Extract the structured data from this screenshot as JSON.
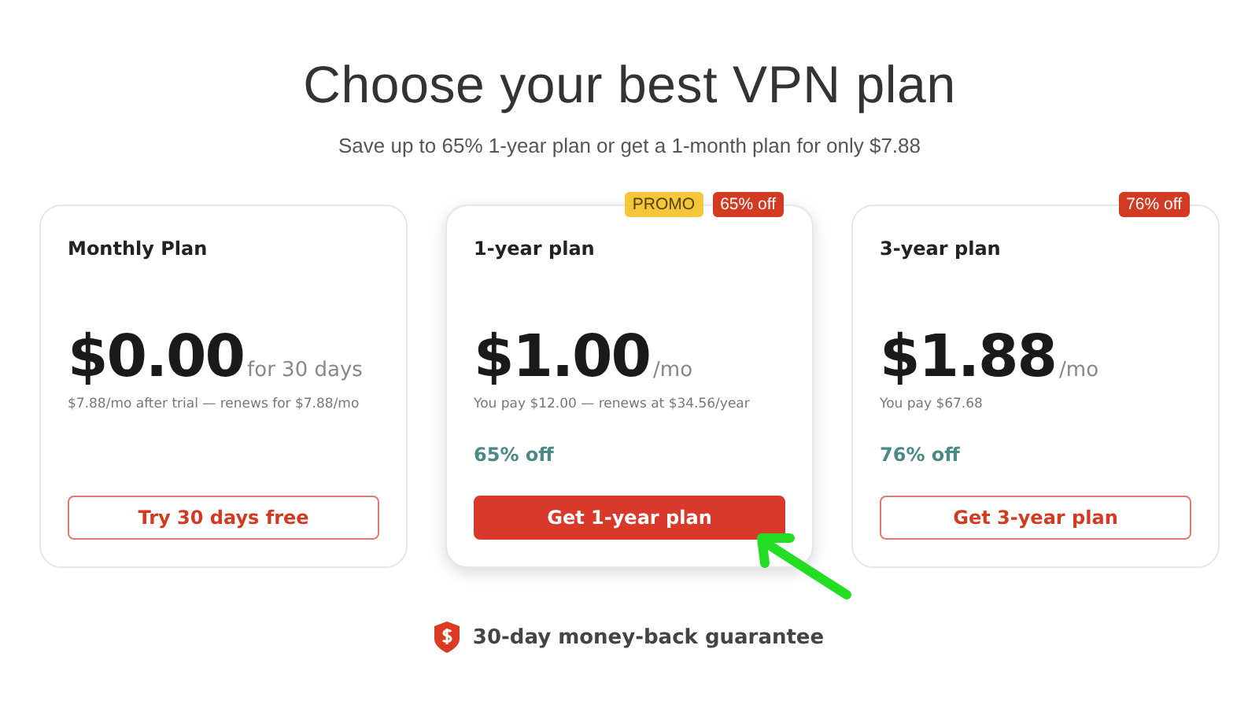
{
  "heading": "Choose your best VPN plan",
  "subheading": "Save up to 65% 1-year plan or get a 1-month plan for only $7.88",
  "plans": [
    {
      "name": "Monthly Plan",
      "featured": false,
      "price": "$0.00",
      "period": "for 30 days",
      "note": "$7.88/mo after trial — renews for $7.88/mo",
      "button": "Try 30 days free"
    },
    {
      "name": "1-year plan",
      "featured": true,
      "badges": [
        {
          "kind": "promo",
          "text": "PROMO"
        },
        {
          "kind": "discount",
          "text": "65% off"
        }
      ],
      "price": "$1.00",
      "period": "/mo",
      "note": "You pay $12.00 — renews at $34.56/year",
      "discount": "65% off",
      "button": "Get 1-year plan"
    },
    {
      "name": "3-year plan",
      "featured": false,
      "badges": [
        {
          "kind": "discount",
          "text": "76% off"
        }
      ],
      "price": "$1.88",
      "period": "/mo",
      "note": "You pay $67.68",
      "discount": "76% off",
      "button": "Get 3-year plan"
    }
  ],
  "guarantee": "30-day money-back guarantee",
  "annotation": {
    "kind": "arrow"
  }
}
